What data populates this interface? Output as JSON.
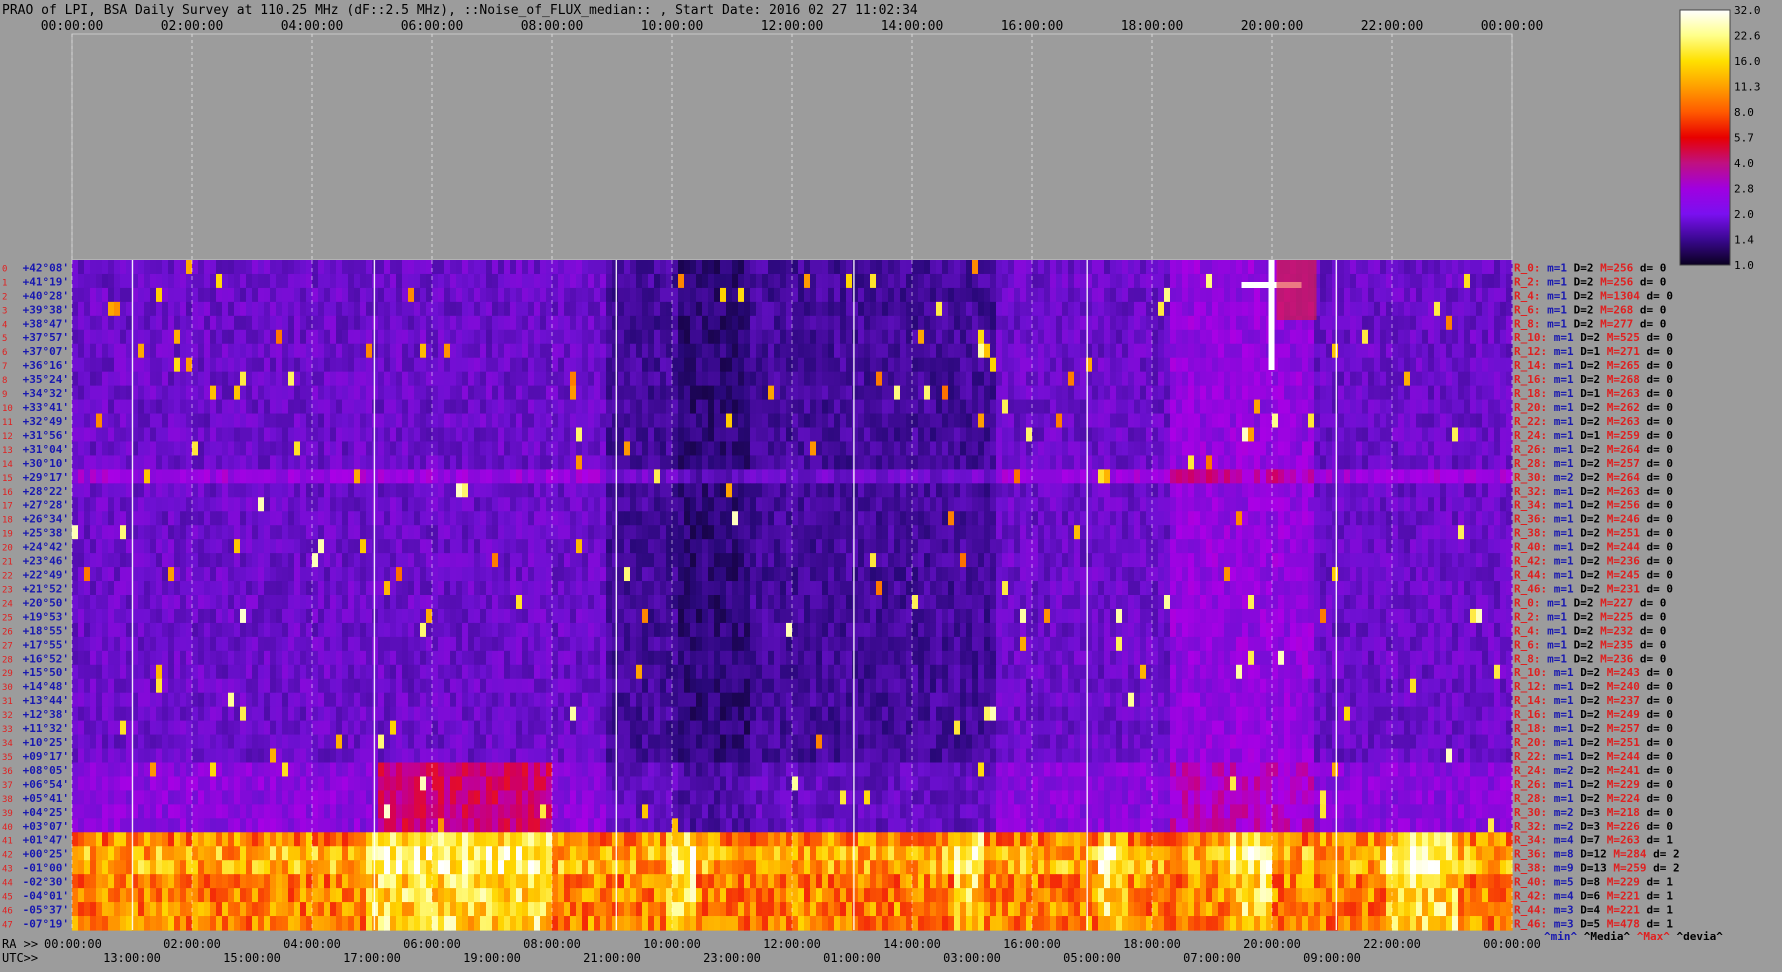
{
  "title": "PRAO of LPI, BSA Daily Survey at 110.25 MHz (dF::2.5 MHz), ::Noise_of_FLUX_median:: , Start Date: 2016 02 27 11:02:34",
  "chart_data": {
    "type": "heatmap",
    "title": "PRAO of LPI, BSA Daily Survey at 110.25 MHz (dF::2.5 MHz), ::Noise_of_FLUX_median:: , Start Date: 2016 02 27 11:02:34",
    "x_axis_top_ticks": [
      "00:00:00",
      "02:00:00",
      "04:00:00",
      "06:00:00",
      "08:00:00",
      "10:00:00",
      "12:00:00",
      "14:00:00",
      "16:00:00",
      "18:00:00",
      "20:00:00",
      "22:00:00",
      "00:00:00"
    ],
    "x_axis_bottom_ra_label": "RA >>",
    "x_axis_bottom_ra_ticks": [
      "00:00:00",
      "02:00:00",
      "04:00:00",
      "06:00:00",
      "08:00:00",
      "10:00:00",
      "12:00:00",
      "14:00:00",
      "16:00:00",
      "18:00:00",
      "20:00:00",
      "22:00:00",
      "00:00:00"
    ],
    "x_axis_bottom_utc_label": "UTC>>",
    "x_axis_bottom_utc_ticks": [
      "13:00:00",
      "15:00:00",
      "17:00:00",
      "19:00:00",
      "21:00:00",
      "23:00:00",
      "01:00:00",
      "03:00:00",
      "05:00:00",
      "07:00:00",
      "09:00:00"
    ],
    "y_axis_labels": [
      "+42°08'",
      "+41°19'",
      "+40°28'",
      "+39°38'",
      "+38°47'",
      "+37°57'",
      "+37°07'",
      "+36°16'",
      "+35°24'",
      "+34°32'",
      "+33°41'",
      "+32°49'",
      "+31°56'",
      "+31°04'",
      "+30°10'",
      "+29°17'",
      "+28°22'",
      "+27°28'",
      "+26°34'",
      "+25°38'",
      "+24°42'",
      "+23°46'",
      "+22°49'",
      "+21°52'",
      "+20°50'",
      "+19°53'",
      "+18°55'",
      "+17°55'",
      "+16°52'",
      "+15°50'",
      "+14°48'",
      "+13°44'",
      "+12°38'",
      "+11°32'",
      "+10°25'",
      "+09°17'",
      "+08°05'",
      "+06°54'",
      "+05°41'",
      "+04°25'",
      "+03°07'",
      "+01°47'",
      "+00°25'",
      "-01°00'",
      "-02°30'",
      "-04°01'",
      "-05°37'",
      "-07°19'"
    ],
    "colorbar_ticks": [
      "32.0",
      "22.6",
      "16.0",
      "11.3",
      "8.0",
      "5.7",
      "4.0",
      "2.8",
      "2.0",
      "1.4",
      "1.0"
    ],
    "colorbar_colors": [
      "#ffffff",
      "#ffff8a",
      "#ffe000",
      "#ffa000",
      "#ff5a00",
      "#e80000",
      "#c01080",
      "#a000e0",
      "#7a10f0",
      "#3a0890",
      "#0a0020"
    ],
    "right_panel": [
      {
        "r": "R_0:",
        "m": "m=1",
        "d": "D=2",
        "mx": "M=256",
        "dev": "d= 0"
      },
      {
        "r": "R_2:",
        "m": "m=1",
        "d": "D=2",
        "mx": "M=256",
        "dev": "d= 0"
      },
      {
        "r": "R_4:",
        "m": "m=1",
        "d": "D=2",
        "mx": "M=1304",
        "dev": "d= 0"
      },
      {
        "r": "R_6:",
        "m": "m=1",
        "d": "D=2",
        "mx": "M=268",
        "dev": "d= 0"
      },
      {
        "r": "R_8:",
        "m": "m=1",
        "d": "D=2",
        "mx": "M=277",
        "dev": "d= 0"
      },
      {
        "r": "R_10:",
        "m": "m=1",
        "d": "D=2",
        "mx": "M=525",
        "dev": "d= 0"
      },
      {
        "r": "R_12:",
        "m": "m=1",
        "d": "D=1",
        "mx": "M=271",
        "dev": "d= 0"
      },
      {
        "r": "R_14:",
        "m": "m=1",
        "d": "D=2",
        "mx": "M=265",
        "dev": "d= 0"
      },
      {
        "r": "R_16:",
        "m": "m=1",
        "d": "D=2",
        "mx": "M=268",
        "dev": "d= 0"
      },
      {
        "r": "R_18:",
        "m": "m=1",
        "d": "D=1",
        "mx": "M=263",
        "dev": "d= 0"
      },
      {
        "r": "R_20:",
        "m": "m=1",
        "d": "D=2",
        "mx": "M=262",
        "dev": "d= 0"
      },
      {
        "r": "R_22:",
        "m": "m=1",
        "d": "D=2",
        "mx": "M=263",
        "dev": "d= 0"
      },
      {
        "r": "R_24:",
        "m": "m=1",
        "d": "D=1",
        "mx": "M=259",
        "dev": "d= 0"
      },
      {
        "r": "R_26:",
        "m": "m=1",
        "d": "D=2",
        "mx": "M=264",
        "dev": "d= 0"
      },
      {
        "r": "R_28:",
        "m": "m=1",
        "d": "D=2",
        "mx": "M=257",
        "dev": "d= 0"
      },
      {
        "r": "R_30:",
        "m": "m=2",
        "d": "D=2",
        "mx": "M=264",
        "dev": "d= 0"
      },
      {
        "r": "R_32:",
        "m": "m=1",
        "d": "D=2",
        "mx": "M=263",
        "dev": "d= 0"
      },
      {
        "r": "R_34:",
        "m": "m=1",
        "d": "D=2",
        "mx": "M=256",
        "dev": "d= 0"
      },
      {
        "r": "R_36:",
        "m": "m=1",
        "d": "D=2",
        "mx": "M=246",
        "dev": "d= 0"
      },
      {
        "r": "R_38:",
        "m": "m=1",
        "d": "D=2",
        "mx": "M=251",
        "dev": "d= 0"
      },
      {
        "r": "R_40:",
        "m": "m=1",
        "d": "D=2",
        "mx": "M=244",
        "dev": "d= 0"
      },
      {
        "r": "R_42:",
        "m": "m=1",
        "d": "D=2",
        "mx": "M=236",
        "dev": "d= 0"
      },
      {
        "r": "R_44:",
        "m": "m=1",
        "d": "D=2",
        "mx": "M=245",
        "dev": "d= 0"
      },
      {
        "r": "R_46:",
        "m": "m=1",
        "d": "D=2",
        "mx": "M=231",
        "dev": "d= 0"
      },
      {
        "r": "R_0:",
        "m": "m=1",
        "d": "D=2",
        "mx": "M=227",
        "dev": "d= 0"
      },
      {
        "r": "R_2:",
        "m": "m=1",
        "d": "D=2",
        "mx": "M=225",
        "dev": "d= 0"
      },
      {
        "r": "R_4:",
        "m": "m=1",
        "d": "D=2",
        "mx": "M=232",
        "dev": "d= 0"
      },
      {
        "r": "R_6:",
        "m": "m=1",
        "d": "D=2",
        "mx": "M=235",
        "dev": "d= 0"
      },
      {
        "r": "R_8:",
        "m": "m=1",
        "d": "D=2",
        "mx": "M=236",
        "dev": "d= 0"
      },
      {
        "r": "R_10:",
        "m": "m=1",
        "d": "D=2",
        "mx": "M=243",
        "dev": "d= 0"
      },
      {
        "r": "R_12:",
        "m": "m=1",
        "d": "D=2",
        "mx": "M=240",
        "dev": "d= 0"
      },
      {
        "r": "R_14:",
        "m": "m=1",
        "d": "D=2",
        "mx": "M=237",
        "dev": "d= 0"
      },
      {
        "r": "R_16:",
        "m": "m=1",
        "d": "D=2",
        "mx": "M=249",
        "dev": "d= 0"
      },
      {
        "r": "R_18:",
        "m": "m=1",
        "d": "D=2",
        "mx": "M=257",
        "dev": "d= 0"
      },
      {
        "r": "R_20:",
        "m": "m=1",
        "d": "D=2",
        "mx": "M=251",
        "dev": "d= 0"
      },
      {
        "r": "R_22:",
        "m": "m=1",
        "d": "D=2",
        "mx": "M=244",
        "dev": "d= 0"
      },
      {
        "r": "R_24:",
        "m": "m=2",
        "d": "D=2",
        "mx": "M=241",
        "dev": "d= 0"
      },
      {
        "r": "R_26:",
        "m": "m=1",
        "d": "D=2",
        "mx": "M=229",
        "dev": "d= 0"
      },
      {
        "r": "R_28:",
        "m": "m=1",
        "d": "D=2",
        "mx": "M=224",
        "dev": "d= 0"
      },
      {
        "r": "R_30:",
        "m": "m=2",
        "d": "D=3",
        "mx": "M=218",
        "dev": "d= 0"
      },
      {
        "r": "R_32:",
        "m": "m=2",
        "d": "D=3",
        "mx": "M=226",
        "dev": "d= 0"
      },
      {
        "r": "R_34:",
        "m": "m=4",
        "d": "D=7",
        "mx": "M=263",
        "dev": "d= 1"
      },
      {
        "r": "R_36:",
        "m": "m=8",
        "d": "D=12",
        "mx": "M=284",
        "dev": "d= 2"
      },
      {
        "r": "R_38:",
        "m": "m=9",
        "d": "D=13",
        "mx": "M=259",
        "dev": "d= 2"
      },
      {
        "r": "R_40:",
        "m": "m=5",
        "d": "D=8",
        "mx": "M=229",
        "dev": "d= 1"
      },
      {
        "r": "R_42:",
        "m": "m=4",
        "d": "D=6",
        "mx": "M=221",
        "dev": "d= 1"
      },
      {
        "r": "R_44:",
        "m": "m=3",
        "d": "D=4",
        "mx": "M=221",
        "dev": "d= 1"
      },
      {
        "r": "R_46:",
        "m": "m=3",
        "d": "D=5",
        "mx": "M=478",
        "dev": "d= 1"
      }
    ],
    "legend": {
      "min": "^min^",
      "median": "^Media^",
      "max": "^Max^",
      "devia": "^devia^"
    }
  },
  "colors": {
    "background": "#9c9c9c",
    "row_label_blue": "#1818b0",
    "row_label_red": "#e02020",
    "heat_dark": "#1a0850",
    "heat_purple": "#7a10d0",
    "heat_red": "#e01020",
    "heat_yellow": "#ffe000"
  }
}
